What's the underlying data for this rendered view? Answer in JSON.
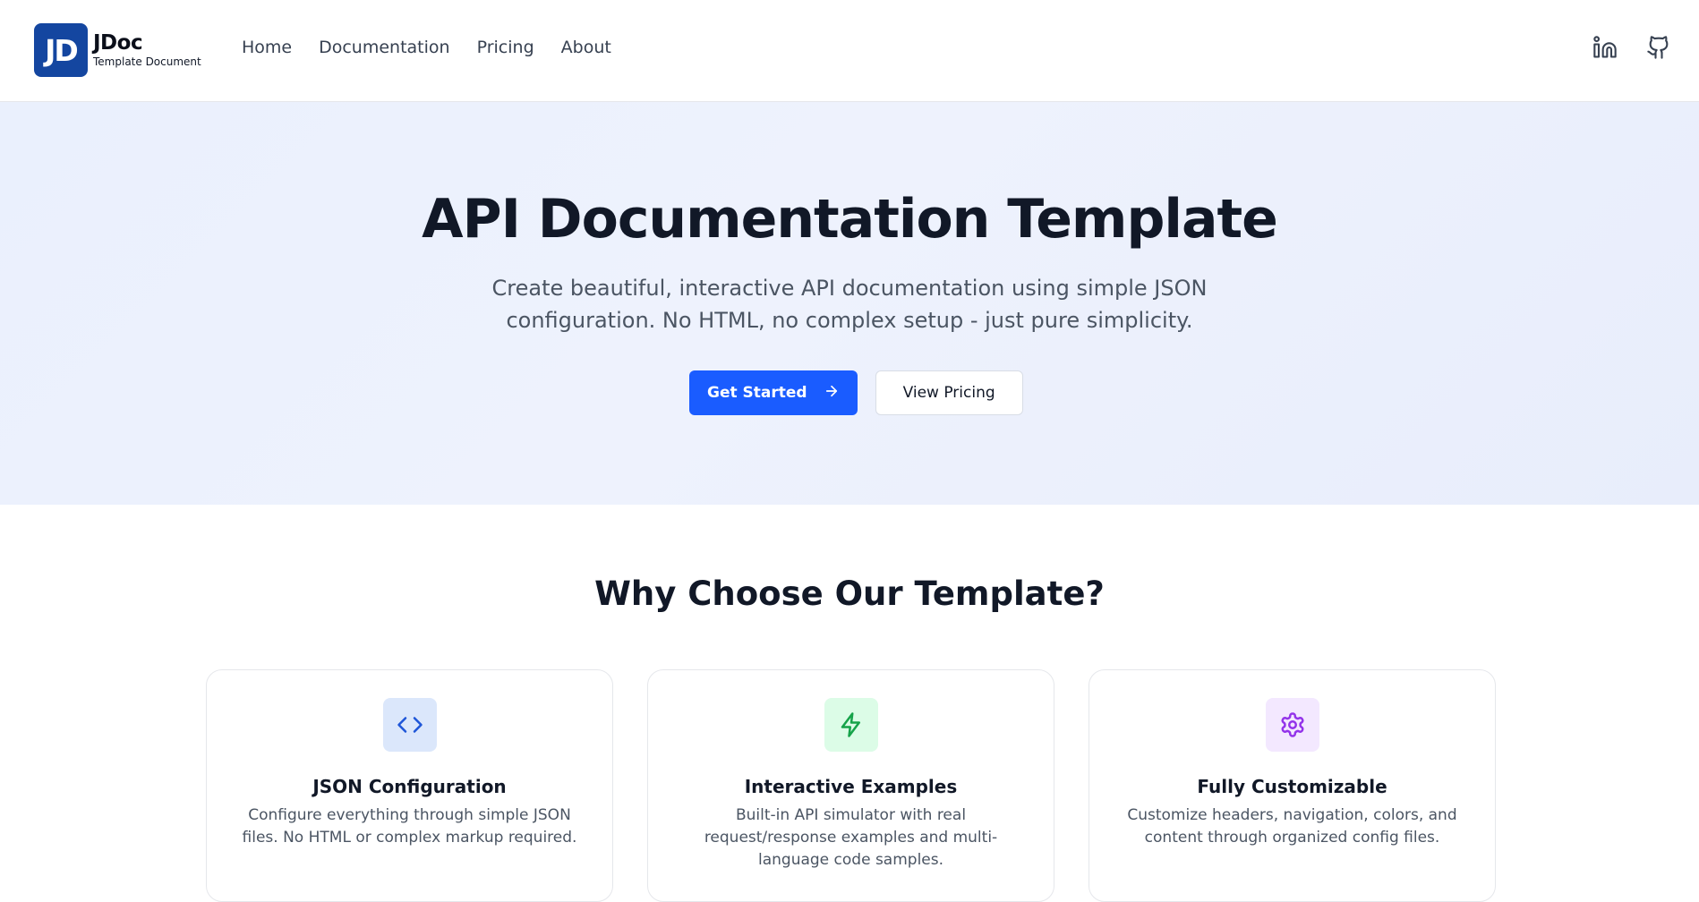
{
  "header": {
    "logo_mark": "JD",
    "logo_name": "JDoc",
    "logo_tagline": "Template Document",
    "nav": [
      {
        "label": "Home"
      },
      {
        "label": "Documentation"
      },
      {
        "label": "Pricing"
      },
      {
        "label": "About"
      }
    ],
    "social": [
      {
        "icon": "linkedin-icon"
      },
      {
        "icon": "github-icon"
      }
    ]
  },
  "hero": {
    "title": "API Documentation Template",
    "subtitle": "Create beautiful, interactive API documentation using simple JSON configuration. No HTML, no complex setup - just pure simplicity.",
    "primary_cta": "Get Started",
    "secondary_cta": "View Pricing"
  },
  "features": {
    "title": "Why Choose Our Template?",
    "cards": [
      {
        "icon": "code-icon",
        "title": "JSON Configuration",
        "description": "Configure everything through simple JSON files. No HTML or complex markup required.",
        "icon_color": "#1e56d8",
        "icon_bg": "#dbe7fb"
      },
      {
        "icon": "lightning-icon",
        "title": "Interactive Examples",
        "description": "Built-in API simulator with real request/response examples and multi-language code samples.",
        "icon_color": "#16a34a",
        "icon_bg": "#dcfce7"
      },
      {
        "icon": "gear-icon",
        "title": "Fully Customizable",
        "description": "Customize headers, navigation, colors, and content through organized config files.",
        "icon_color": "#9333ea",
        "icon_bg": "#f3e8ff"
      }
    ]
  },
  "colors": {
    "primary": "#1a5cff",
    "logo_bg": "#1446a0",
    "hero_bg": "#eaf0fd"
  }
}
